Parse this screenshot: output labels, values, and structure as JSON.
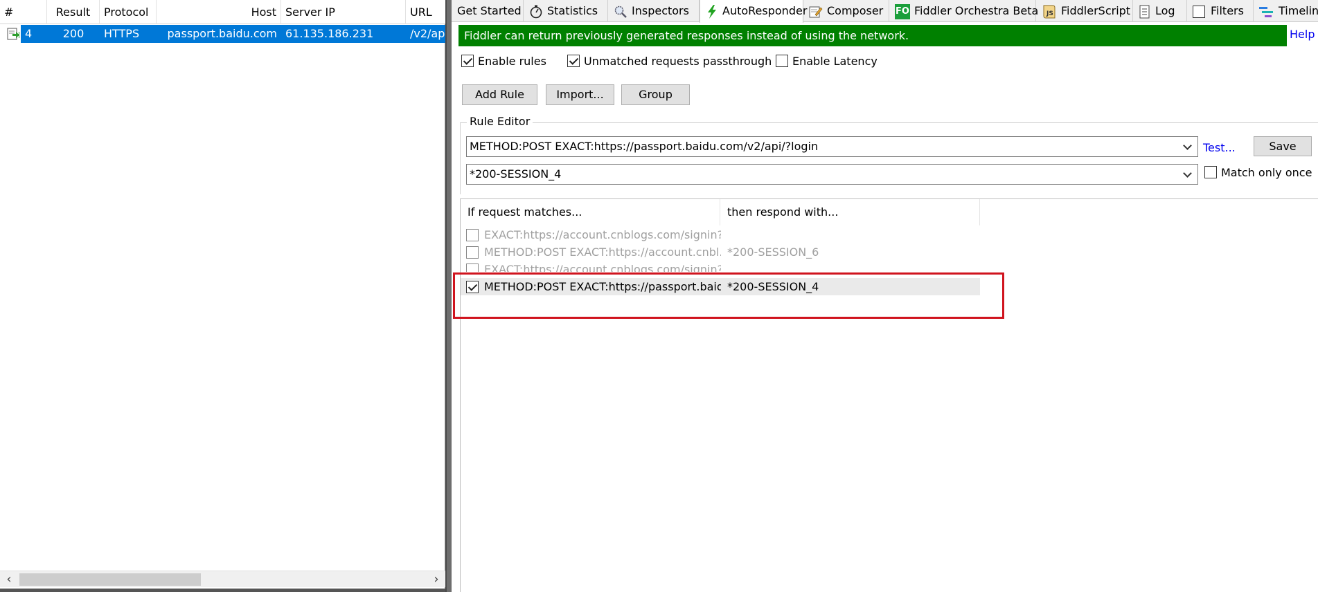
{
  "sessions": {
    "columns": [
      "#",
      "Result",
      "Protocol",
      "Host",
      "Server IP",
      "URL"
    ],
    "rows": [
      {
        "num": "4",
        "result": "200",
        "protocol": "HTTPS",
        "host": "passport.baidu.com",
        "server_ip": "61.135.186.231",
        "url": "/v2/ap"
      }
    ]
  },
  "tabs": [
    {
      "label": "Get Started",
      "icon": ""
    },
    {
      "label": "Statistics",
      "icon": "stopwatch-icon"
    },
    {
      "label": "Inspectors",
      "icon": "magnifier-icon"
    },
    {
      "label": "AutoResponder",
      "icon": "lightning-icon"
    },
    {
      "label": "Composer",
      "icon": "compose-icon"
    },
    {
      "label": "Fiddler Orchestra Beta",
      "icon": "fo-icon",
      "badge": "FO"
    },
    {
      "label": "FiddlerScript",
      "icon": "script-icon",
      "badge": "JS"
    },
    {
      "label": "Log",
      "icon": "log-icon"
    },
    {
      "label": "Filters",
      "icon": "checkbox-icon"
    },
    {
      "label": "Timeline",
      "icon": "timeline-icon"
    }
  ],
  "autoresponder": {
    "banner": "Fiddler can return previously generated responses instead of using the network.",
    "help": "Help",
    "enable_rules": "Enable rules",
    "unmatched_passthrough": "Unmatched requests passthrough",
    "enable_latency": "Enable Latency",
    "add_rule": "Add Rule",
    "import": "Import...",
    "group": "Group",
    "rule_editor_label": "Rule Editor",
    "match_value": "METHOD:POST EXACT:https://passport.baidu.com/v2/api/?login",
    "respond_value": "*200-SESSION_4",
    "test_link": "Test...",
    "save": "Save",
    "match_only_once": "Match only once",
    "list_headers": [
      "If request matches...",
      "then respond with..."
    ],
    "rules": [
      {
        "match": "EXACT:https://account.cnblogs.com/signin?r...",
        "respond": "",
        "checked": false
      },
      {
        "match": "METHOD:POST EXACT:https://account.cnbl...",
        "respond": "*200-SESSION_6",
        "checked": false
      },
      {
        "match": "EXACT:https://account.cnblogs.com/signin?r...",
        "respond": "",
        "checked": false
      },
      {
        "match": "METHOD:POST EXACT:https://passport.baid...",
        "respond": "*200-SESSION_4",
        "checked": true
      }
    ]
  },
  "colors": {
    "selection": "#0078d7",
    "banner": "#008000",
    "link": "#0000ee",
    "highlight_box": "#d0141e"
  }
}
